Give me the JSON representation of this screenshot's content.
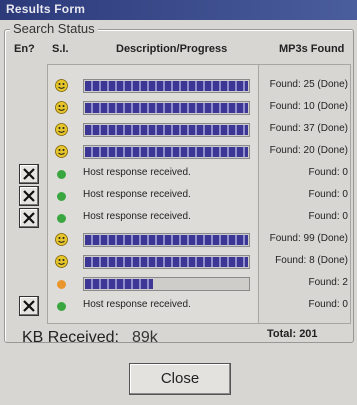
{
  "window": {
    "title": "Results Form"
  },
  "group": {
    "label": "Search Status"
  },
  "headers": {
    "en": "En?",
    "si": "S.I.",
    "desc": "Description/Progress",
    "mp3": "MP3s Found"
  },
  "rows": [
    {
      "en": false,
      "si": "smiley-icon",
      "progress": 1.0,
      "description": "",
      "found": "Found: 25 (Done)"
    },
    {
      "en": false,
      "si": "smiley-icon",
      "progress": 1.0,
      "description": "",
      "found": "Found: 10 (Done)"
    },
    {
      "en": false,
      "si": "smiley-icon",
      "progress": 1.0,
      "description": "",
      "found": "Found: 37 (Done)"
    },
    {
      "en": false,
      "si": "smiley-icon",
      "progress": 1.0,
      "description": "",
      "found": "Found: 20 (Done)"
    },
    {
      "en": true,
      "si": "green-status-dot-icon",
      "progress": null,
      "description": "Host response received.",
      "found": "Found: 0"
    },
    {
      "en": true,
      "si": "green-status-dot-icon",
      "progress": null,
      "description": "Host response received.",
      "found": "Found: 0"
    },
    {
      "en": true,
      "si": "green-status-dot-icon",
      "progress": null,
      "description": "Host response received.",
      "found": "Found: 0"
    },
    {
      "en": false,
      "si": "smiley-icon",
      "progress": 1.0,
      "description": "",
      "found": "Found: 99 (Done)"
    },
    {
      "en": false,
      "si": "smiley-icon",
      "progress": 1.0,
      "description": "",
      "found": "Found: 8 (Done)"
    },
    {
      "en": false,
      "si": "orange-status-dot-icon",
      "progress": 0.42,
      "description": "",
      "found": "Found: 2"
    },
    {
      "en": true,
      "si": "green-status-dot-icon",
      "progress": null,
      "description": "Host response received.",
      "found": "Found: 0"
    }
  ],
  "kb": {
    "label": "KB Received:",
    "value": "89k"
  },
  "total": {
    "label": "Total:",
    "value": "201"
  },
  "close_label": "Close",
  "colors": {
    "titlebar": "#2c3a7a",
    "progress": "#3c3794",
    "green_dot": "#3aa640",
    "orange_dot": "#e9962d",
    "smiley": "#e5c52a"
  }
}
